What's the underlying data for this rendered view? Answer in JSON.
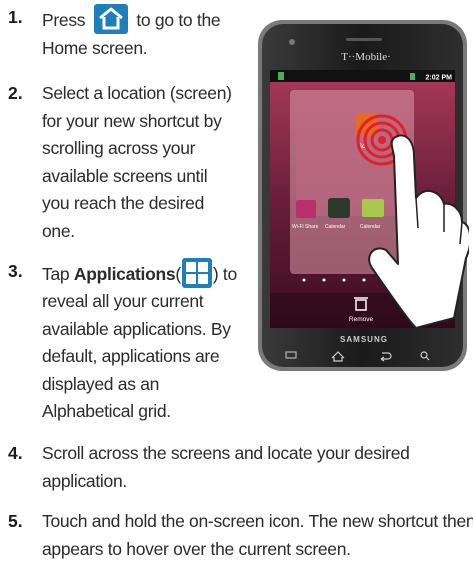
{
  "steps": [
    {
      "num": "1.",
      "pre": "Press",
      "post": "to go to the",
      "cont": "Home screen.",
      "icon": "home-icon"
    },
    {
      "num": "2.",
      "lines": [
        "Select a location (screen)",
        "for your new shortcut by",
        "scrolling across your",
        "available screens until",
        "you reach the desired",
        "one."
      ]
    },
    {
      "num": "3.",
      "pre": "Tap",
      "bold": "Applications",
      "open": "(",
      "close": ") to",
      "lines": [
        "reveal all your current",
        "available applications. By",
        "default, applications are",
        "displayed as an",
        "Alphabetical grid."
      ],
      "icon": "applications-icon"
    },
    {
      "num": "4.",
      "lines": [
        "Scroll across the screens and locate your desired",
        "application."
      ]
    },
    {
      "num": "5.",
      "lines": [
        "Touch and hold the on-screen icon. The new shortcut then",
        "appears to hover over the current screen."
      ]
    }
  ],
  "phone": {
    "carrier": "T··Mobile·",
    "time": "2:02 PM",
    "brand": "SAMSUNG",
    "remove_label": "Remove",
    "dock_labels": [
      "Wi-Fi Share",
      "Calendar",
      "Calendar"
    ],
    "shortcut_label": "Sc"
  }
}
